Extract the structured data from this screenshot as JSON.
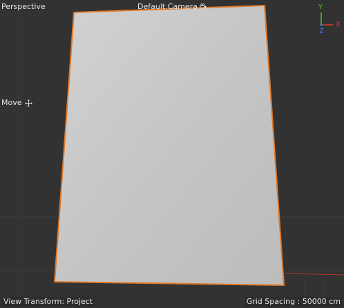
{
  "viewport": {
    "projection_label": "Perspective",
    "camera_label": "Default Camera",
    "tool_label": "Move",
    "view_transform": "View Transform: Project",
    "grid_spacing": "Grid Spacing : 50000 cm"
  },
  "axes": {
    "x_label": "X",
    "y_label": "Y",
    "z_label": "Z",
    "x_color": "#d43a2a",
    "y_color": "#5fbf2f",
    "z_color": "#3f7fe0"
  },
  "icons": {
    "camera": "camera-icon",
    "move": "move-cross-icon"
  },
  "colors": {
    "background": "#323232",
    "grid_line": "#3e3e3e",
    "plane_fill": "#c3c3c3",
    "selection_outline": "#e07a2a"
  }
}
